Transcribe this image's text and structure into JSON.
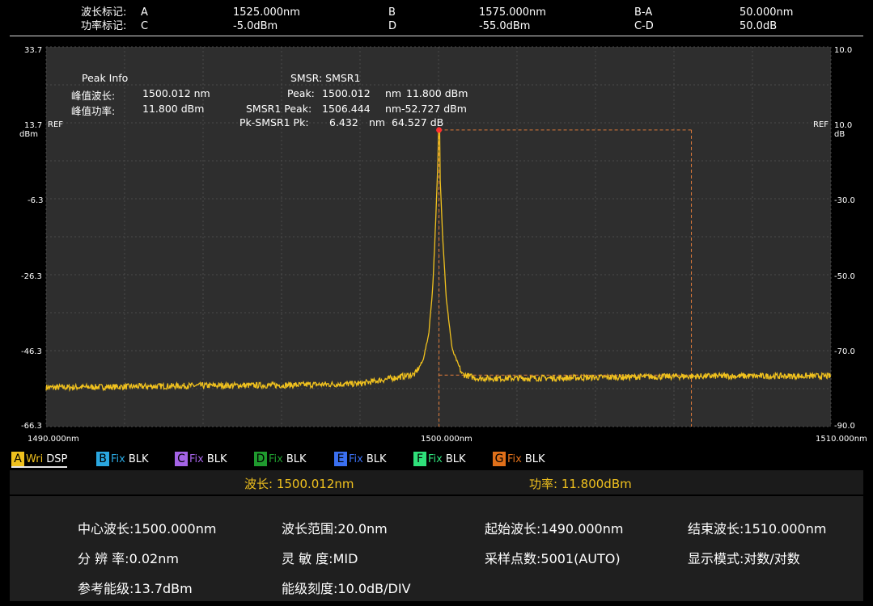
{
  "markers": {
    "wave_label": "波长标记:",
    "power_label": "功率标记:",
    "a": {
      "name": "A",
      "value": "1525.000nm"
    },
    "b": {
      "name": "B",
      "value": "1575.000nm"
    },
    "ba": {
      "name": "B-A",
      "value": "50.000nm"
    },
    "c": {
      "name": "C",
      "value": "-5.0dBm"
    },
    "d": {
      "name": "D",
      "value": "-55.0dBm"
    },
    "cd": {
      "name": "C-D",
      "value": "50.0dB"
    }
  },
  "plot": {
    "y_ticks_left": [
      "33.7",
      "13.7",
      "-6.3",
      "-26.3",
      "-46.3",
      "-66.3"
    ],
    "y_ticks_right": [
      "10.0",
      "10.0",
      "-30.0",
      "-50.0",
      "-70.0",
      "-90.0"
    ],
    "unit_left": "dBm",
    "unit_right": "dB",
    "ref_label": "REF",
    "x_ticks": [
      "1490.000nm",
      "1500.000nm",
      "1510.000nm"
    ]
  },
  "peak_info": {
    "title": "Peak Info",
    "wl_label": "峰值波长:",
    "wl_value": "1500.012 nm",
    "pw_label": "峰值功率:",
    "pw_value": "11.800 dBm"
  },
  "smsr": {
    "title": "SMSR: SMSR1",
    "peak_label": "Peak:",
    "peak_wl": "1500.012",
    "peak_wl_unit": "nm",
    "peak_pw": "11.800 dBm",
    "smsr1_label": "SMSR1 Peak:",
    "smsr1_wl": "1506.444",
    "smsr1_wl_unit": "nm",
    "smsr1_pw": "-52.727 dBm",
    "pk_label": "Pk-SMSR1 Pk:",
    "pk_wl": "6.432",
    "pk_wl_unit": "nm",
    "pk_db": "64.527 dB"
  },
  "traces": [
    {
      "letter": "A",
      "mode": "Wri",
      "state": "DSP",
      "color": "#f0c11e"
    },
    {
      "letter": "B",
      "mode": "Fix",
      "state": "BLK",
      "color": "#2aa7e0"
    },
    {
      "letter": "C",
      "mode": "Fix",
      "state": "BLK",
      "color": "#a463e6"
    },
    {
      "letter": "D",
      "mode": "Fix",
      "state": "BLK",
      "color": "#1f9a2e"
    },
    {
      "letter": "E",
      "mode": "Fix",
      "state": "BLK",
      "color": "#3a6ff0"
    },
    {
      "letter": "F",
      "mode": "Fix",
      "state": "BLK",
      "color": "#2fe07a"
    },
    {
      "letter": "G",
      "mode": "Fix",
      "state": "BLK",
      "color": "#e0701a"
    }
  ],
  "readout": {
    "wavelength": "波长: 1500.012nm",
    "power": "功率: 11.800dBm"
  },
  "params": {
    "center": "中心波长:1500.000nm",
    "span": "波长范围:20.0nm",
    "start": "起始波长:1490.000nm",
    "stop": "结束波长:1510.000nm",
    "resolution": "分 辨 率:0.02nm",
    "sensitivity": "灵 敏 度:MID",
    "points": "采样点数:5001(AUTO)",
    "display": "显示模式:对数/对数",
    "ref_level": "参考能级:13.7dBm",
    "scale": "能级刻度:10.0dB/DIV"
  },
  "chart_data": {
    "type": "line",
    "x_unit": "nm",
    "y_unit": "dBm",
    "xlim": [
      1490.0,
      1510.0
    ],
    "ylim": [
      -66.3,
      33.7
    ],
    "grid": true,
    "series": [
      {
        "color": "#f0c11e",
        "x": [
          1490.0,
          1492.0,
          1494.0,
          1496.0,
          1498.0,
          1499.4,
          1499.6,
          1499.75,
          1499.85,
          1499.93,
          1500.0,
          1500.012,
          1500.03,
          1500.1,
          1500.2,
          1500.35,
          1500.6,
          1501.0,
          1503.0,
          1505.0,
          1507.0,
          1509.0,
          1510.0
        ],
        "y": [
          -56.0,
          -55.8,
          -55.5,
          -55.4,
          -55.0,
          -52.5,
          -49.0,
          -42.0,
          -30.0,
          -12.0,
          8.0,
          11.8,
          2.0,
          -15.0,
          -33.0,
          -46.0,
          -52.5,
          -53.6,
          -53.5,
          -53.2,
          -53.0,
          -53.0,
          -53.0
        ]
      }
    ],
    "peak": {
      "x": 1500.012,
      "y": 11.8
    },
    "smsr_box": {
      "x1": 1500.012,
      "x2": 1506.444,
      "y1": 11.8,
      "y2": -52.727
    }
  }
}
